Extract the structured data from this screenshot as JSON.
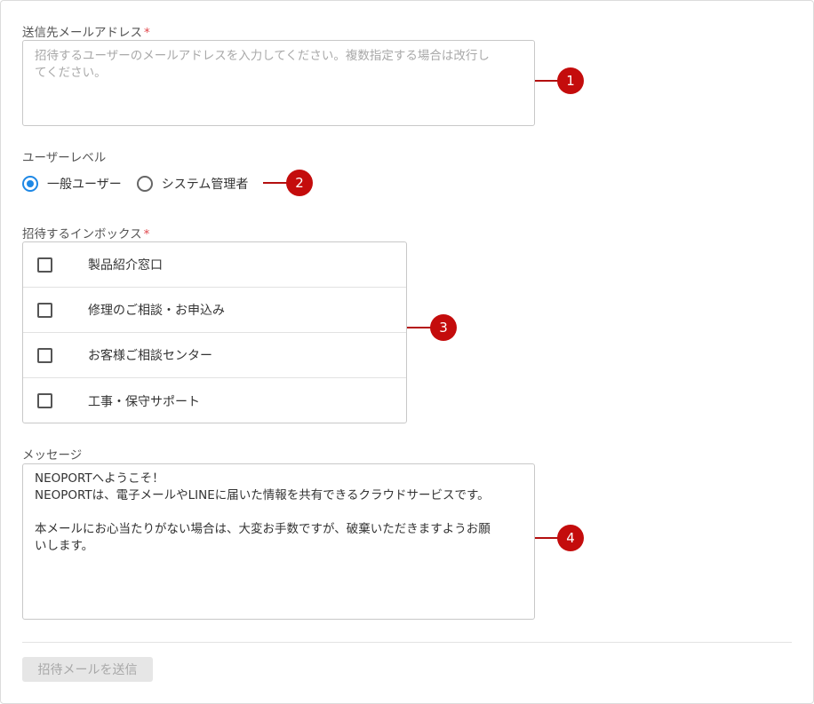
{
  "email_field": {
    "label": "送信先メールアドレス",
    "required_mark": "*",
    "placeholder": "招待するユーザーのメールアドレスを入力してください。複数指定する場合は改行し\nてください。"
  },
  "user_level": {
    "label": "ユーザーレベル",
    "options": [
      {
        "label": "一般ユーザー",
        "checked": true
      },
      {
        "label": "システム管理者",
        "checked": false
      }
    ]
  },
  "inboxes": {
    "label": "招待するインボックス",
    "required_mark": "*",
    "items": [
      {
        "label": "製品紹介窓口",
        "checked": false
      },
      {
        "label": "修理のご相談・お申込み",
        "checked": false
      },
      {
        "label": "お客様ご相談センター",
        "checked": false
      },
      {
        "label": "工事・保守サポート",
        "checked": false
      }
    ]
  },
  "message": {
    "label": "メッセージ",
    "value": "NEOPORTへようこそ！\nNEOPORTは、電子メールやLINEに届いた情報を共有できるクラウドサービスです。\n\n本メールにお心当たりがない場合は、大変お手数ですが、破棄いただきますようお願\nいします。"
  },
  "send_button": {
    "label": "招待メールを送信",
    "disabled": true
  },
  "callouts": [
    "1",
    "2",
    "3",
    "4"
  ],
  "colors": {
    "accent": "#1e88e5",
    "callout": "#c40c0c",
    "required": "#e0474c"
  }
}
